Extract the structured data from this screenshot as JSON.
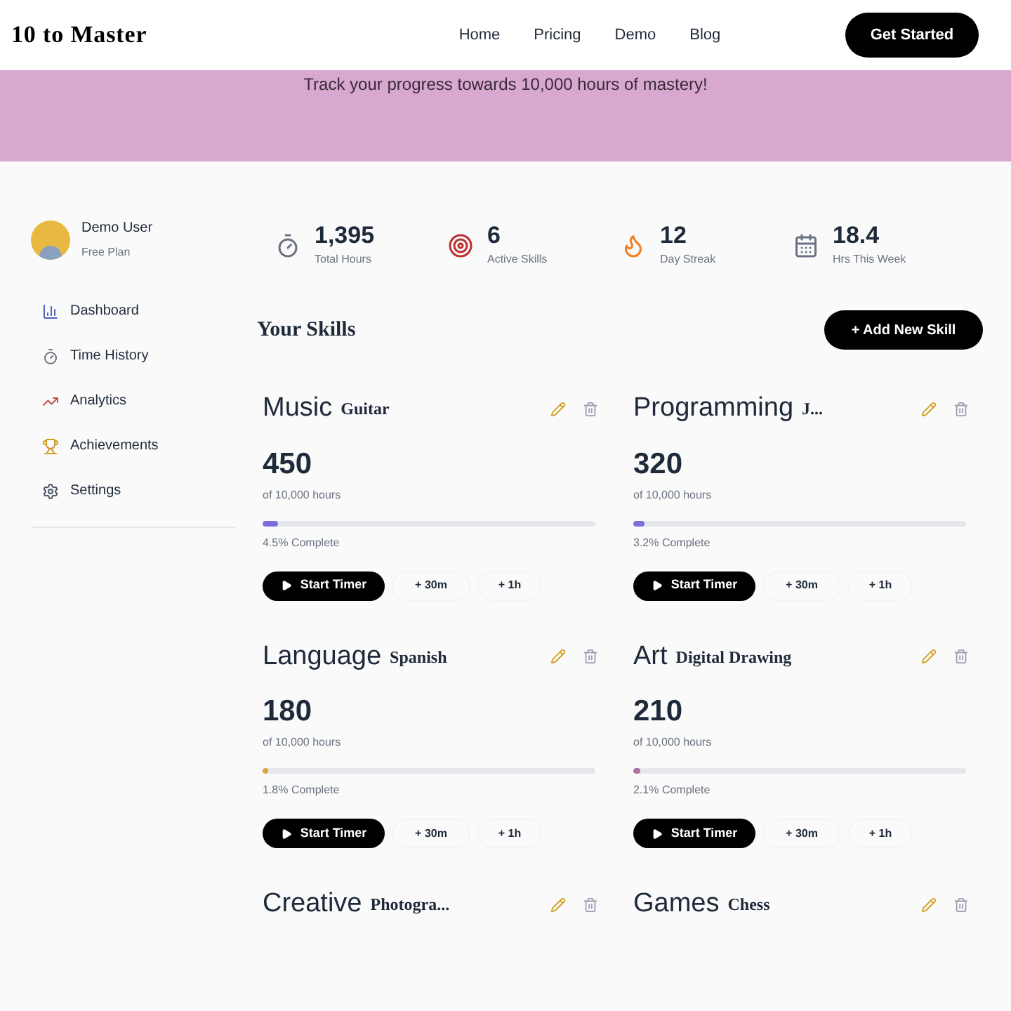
{
  "header": {
    "logo": "10 to Master",
    "nav": [
      "Home",
      "Pricing",
      "Demo",
      "Blog"
    ],
    "cta": "Get Started"
  },
  "banner": {
    "text": "Track your progress towards 10,000 hours of mastery!"
  },
  "user": {
    "name": "Demo User",
    "plan": "Free Plan"
  },
  "sidebar": {
    "items": [
      {
        "label": "Dashboard",
        "kind": "chart"
      },
      {
        "label": "Time History",
        "kind": "timer"
      },
      {
        "label": "Analytics",
        "kind": "trend"
      },
      {
        "label": "Achievements",
        "kind": "trophy"
      },
      {
        "label": "Settings",
        "kind": "gear"
      }
    ]
  },
  "stats": [
    {
      "value": "1,395",
      "label": "Total Hours",
      "kind": "timer"
    },
    {
      "value": "6",
      "label": "Active Skills",
      "kind": "target"
    },
    {
      "value": "12",
      "label": "Day Streak",
      "kind": "flame"
    },
    {
      "value": "18.4",
      "label": "Hrs This Week",
      "kind": "calendar"
    }
  ],
  "skills_title": "Your Skills",
  "add_button": "+ Add New Skill",
  "skills": [
    {
      "name": "Music",
      "sub": "Guitar",
      "hours": "450",
      "of": "of 10,000 hours",
      "level": 0.045,
      "color": "#7b6fe0",
      "complete": "4.5% Complete",
      "start": "Start Timer",
      "add30": "+ 30m",
      "add1h": "+ 1h"
    },
    {
      "name": "Programming",
      "sub": "J...",
      "hours": "320",
      "of": "of 10,000 hours",
      "level": 0.032,
      "color": "#7b6fe0",
      "complete": "3.2% Complete",
      "start": "Start Timer",
      "add30": "+ 30m",
      "add1h": "+ 1h"
    },
    {
      "name": "Language",
      "sub": "Spanish",
      "hours": "180",
      "of": "of 10,000 hours",
      "level": 0.018,
      "color": "#e0a040",
      "complete": "1.8% Complete",
      "start": "Start Timer",
      "add30": "+ 30m",
      "add1h": "+ 1h"
    },
    {
      "name": "Art",
      "sub": "Digital Drawing",
      "hours": "210",
      "of": "of 10,000 hours",
      "level": 0.021,
      "color": "#b070a0",
      "complete": "2.1% Complete",
      "start": "Start Timer",
      "add30": "+ 30m",
      "add1h": "+ 1h"
    },
    {
      "name": "Creative",
      "sub": "Photogra..."
    },
    {
      "name": "Games",
      "sub": "Chess"
    }
  ]
}
